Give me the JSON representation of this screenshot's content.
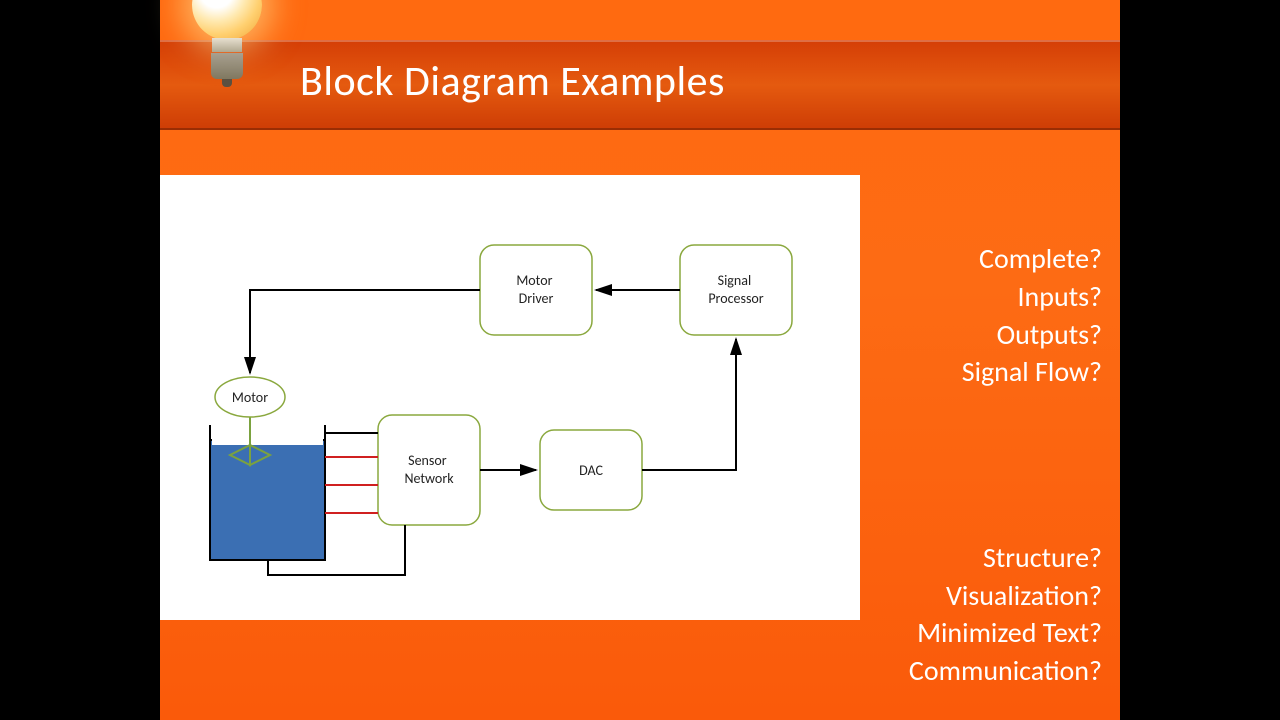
{
  "title": "Block Diagram Examples",
  "questions_top": [
    "Complete?",
    "Inputs?",
    "Outputs?",
    "Signal Flow?"
  ],
  "questions_bottom": [
    "Structure?",
    "Visualization?",
    "Minimized Text?",
    "Communication?"
  ],
  "diagram": {
    "blocks": {
      "motor_driver": "Motor\nDriver",
      "signal_processor": "Signal\nProcessor",
      "sensor_network": "Sensor\nNetwork",
      "dac": "DAC",
      "motor": "Motor"
    },
    "flow_sequence": [
      "Tank sensors",
      "Sensor Network",
      "DAC",
      "Signal Processor",
      "Motor Driver",
      "Motor (in tank)"
    ]
  }
}
